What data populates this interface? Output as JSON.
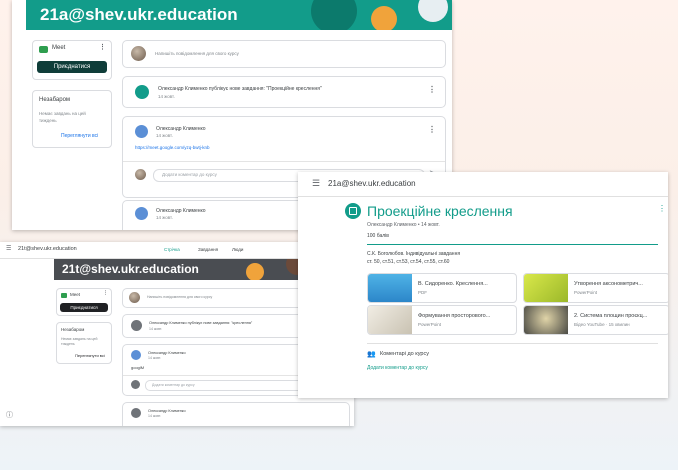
{
  "top": {
    "email": "21a@shev.ukr.education",
    "meet": {
      "label": "Meet",
      "join": "Приєднатися"
    },
    "due": {
      "title": "Незабаром",
      "text1": "Немає завдань на цей",
      "text2": "тиждень",
      "link": "Переглянути всі"
    },
    "composer_placeholder": "Напишіть повідомлення для свого курсу",
    "assignment_post": {
      "title": "Олександр Клименко публікує нове завдання: \"Проекційне креслення\"",
      "date": "14 жовт."
    },
    "post1": {
      "author": "Олександр Клименко",
      "date": "14 жовт.",
      "link": "https://meet.google.com/yzq-bwtj-knb"
    },
    "comment_placeholder": "Додати коментар до курсу",
    "post2": {
      "author": "Олександр Клименко",
      "date": "14 жовт."
    }
  },
  "bottom": {
    "header_email": "21t@shev.ukr.education",
    "tabs": [
      "Стрічка",
      "Завдання",
      "Люди"
    ],
    "email": "21t@shev.ukr.education",
    "meet": {
      "label": "Meet",
      "join": "Приєднатися"
    },
    "due": {
      "title": "Незабаром",
      "text1": "Немає завдань на цей",
      "text2": "тиждень",
      "link": "Переглянути всі"
    },
    "composer_placeholder": "Напишіть повідомлення для свого курсу",
    "assignment_post": {
      "title": "Олександр Клименко публікує нове завдання: \"креслення\"",
      "date": "14 жовт."
    },
    "post1": {
      "author": "Олександр Клименко",
      "date": "14 жовт.",
      "link": "googlM"
    },
    "comment_placeholder": "Додати коментар до курсу",
    "post2": {
      "author": "Олександр Клименко",
      "date": "14 жовт."
    }
  },
  "detail": {
    "header_email": "21a@shev.ukr.education",
    "title": "Проекційне креслення",
    "meta": "Олександр Клименко • 14 жовт.",
    "points": "100 балів",
    "instructions1": "С.К. Боголюбов. Індивідуальні завдання",
    "instructions2": "ст. 50, ст.51, ст.53, ст.54, ст.55, ст.60",
    "attachments": [
      {
        "title": "В. Сидоренко. Креслення...",
        "type": "PDF"
      },
      {
        "title": "Утворення аксонометрич...",
        "type": "PowerPoint"
      },
      {
        "title": "Формування просторового...",
        "type": "PowerPoint"
      },
      {
        "title": "2. Система площин проєкц...",
        "type": "Відео YouTube · 15 хвилин"
      }
    ],
    "comments_label": "Коментарі до курсу",
    "add_comment": "Додати коментар до курсу"
  },
  "colors": {
    "brand": "#129c8a",
    "link": "#1a73e8",
    "dark_button": "#0f3d39"
  }
}
